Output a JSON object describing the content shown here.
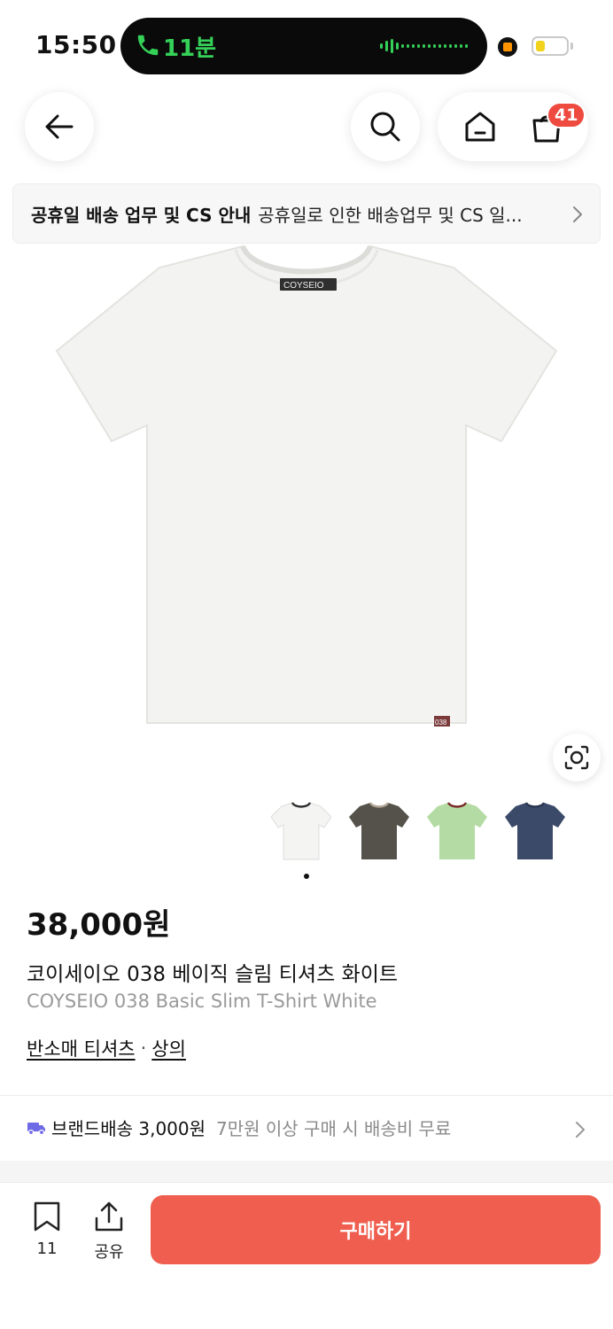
{
  "status_bar": {
    "time": "15:50",
    "call_duration": "11분",
    "battery_level": 0.3,
    "call_color": "#34d058",
    "battery_color": "#f2d21b"
  },
  "nav": {
    "cart_badge": "41"
  },
  "notice": {
    "title": "공휴일 배송 업무 및 CS 안내",
    "text": "공휴일로 인한 배송업무 및 CS 일..."
  },
  "product": {
    "price": "38,000원",
    "name_ko": "코이세이오 038 베이직 슬림 티셔츠 화이트",
    "name_en": "COYSEIO 038 Basic Slim T-Shirt White",
    "label_text": "COYSEIO",
    "tag_text": "038",
    "categories": [
      "반소매 티셔츠",
      "상의"
    ],
    "category_separator": "·",
    "variant_colors": [
      "#f4f4f2",
      "#55524b",
      "#b5dba4",
      "#3c4a6a"
    ],
    "image_index": 1
  },
  "delivery": {
    "label": "브랜드배송 3,000원",
    "sub": "7만원 이상 구매 시 배송비 무료",
    "icon_color": "#6e6ae6"
  },
  "bottom_bar": {
    "bookmark_count": "11",
    "share_label": "공유",
    "buy_label": "구매하기",
    "buy_color": "#ef5e4f"
  }
}
